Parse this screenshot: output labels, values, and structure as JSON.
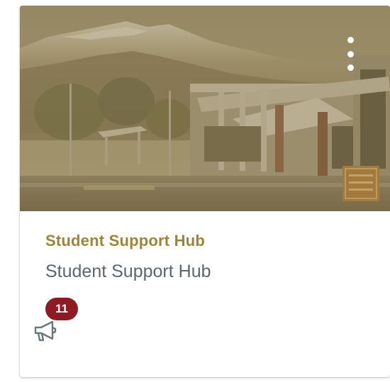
{
  "card": {
    "course_code": "Student Support Hub",
    "course_name": "Student Support Hub",
    "announcements_unread": "11",
    "colors": {
      "overlay": "#8a7a52",
      "course_code": "#a08435",
      "badge": "#8e1b23"
    }
  },
  "icons": {
    "menu": "kebab-vertical-icon",
    "announcements": "megaphone-icon"
  }
}
